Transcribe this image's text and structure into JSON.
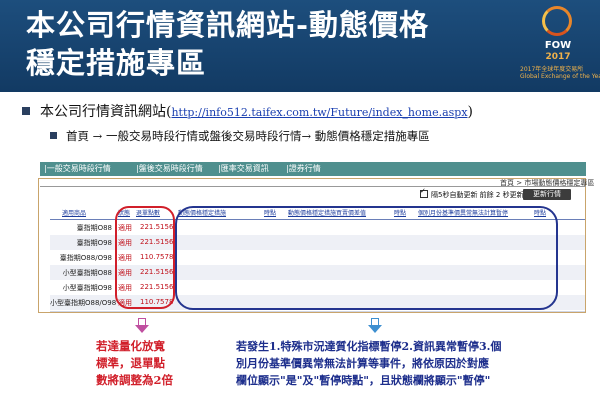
{
  "slide": {
    "title_line1": "本公司行情資訊網站-動態價格",
    "title_line2": "穩定措施專區",
    "logo_brand": "FOW",
    "logo_year": "2017",
    "logo_caption1": "2017年全球年度交易所",
    "logo_caption2": "Global Exchange of the Year"
  },
  "bullets": {
    "b1_text": "本公司行情資訊網站(",
    "b1_url": "http://info512.taifex.com.tw/Future/index_home.aspx",
    "b1_close": ")",
    "b2_text": "首頁 → 一般交易時段行情或盤後交易時段行情→ 動態價格穩定措施專區"
  },
  "site": {
    "nav": [
      "|一般交易時段行情",
      "|盤後交易時段行情",
      "|匯率交易資訊",
      "|證券行情"
    ],
    "breadcrumb": "首頁 > 市場動態價格穩定專區",
    "auto_refresh_label": "隔5秒自動更新 前餘 2 秒更新",
    "refresh_button": "更新行情",
    "columns": [
      "適用商品",
      "狀態",
      "退單點數",
      "動態價格穩定措施",
      "時點",
      "動態價格穩定措施買賣價差值",
      "時點",
      "個別月份基準價異常無法計算暫停",
      "時點"
    ],
    "rows": [
      {
        "name": "臺指期O88",
        "status": "適用",
        "points": "221.5156"
      },
      {
        "name": "臺指期O98",
        "status": "適用",
        "points": "221.5156"
      },
      {
        "name": "臺指期O88/O98",
        "status": "適用",
        "points": "110.7578"
      },
      {
        "name": "小型臺指期O88",
        "status": "適用",
        "points": "221.5156"
      },
      {
        "name": "小型臺指期O98",
        "status": "適用",
        "points": "221.5156"
      },
      {
        "name": "小型臺指期O88/O98",
        "status": "適用",
        "points": "110.7578"
      }
    ]
  },
  "notes": {
    "red": [
      "若達量化放寬",
      "標準，退單點",
      "數將調整為2倍"
    ],
    "blue": [
      "若發生1.特殊市況達質化指標暫停2.資訊異常暫停3.個",
      "別月份基準價異常無法計算等事件，將依原因於對應",
      "欄位顯示\"是\"及\"暫停時點\"，且狀態欄將顯示\"暫停\""
    ]
  },
  "colors": {
    "banner": "#1d4e7d",
    "nav": "#4f8f8e",
    "red": "#d11f2a",
    "blue": "#1d2e8c"
  }
}
